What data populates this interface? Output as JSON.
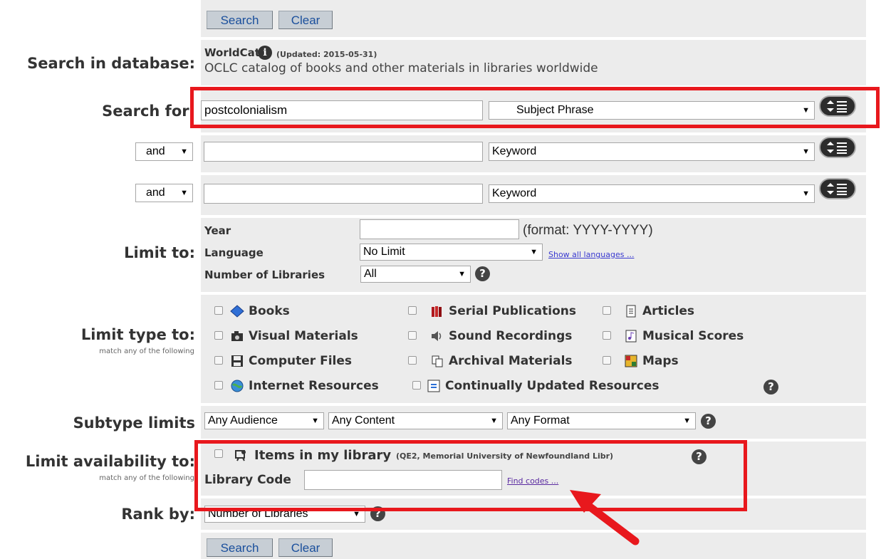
{
  "buttons": {
    "search": "Search",
    "clear": "Clear"
  },
  "database": {
    "label": "Search in database:",
    "name": "WorldCat",
    "updated": "(Updated: 2015-05-31)",
    "description": "OCLC catalog of books and other materials in libraries worldwide"
  },
  "search_for": {
    "label": "Search for:",
    "rows": [
      {
        "value": "postcolonialism",
        "index": "Subject Phrase"
      },
      {
        "bool": "and",
        "value": "",
        "index": "Keyword"
      },
      {
        "bool": "and",
        "value": "",
        "index": "Keyword"
      }
    ]
  },
  "limit_to": {
    "label": "Limit to:",
    "year_label": "Year",
    "year_format": "(format: YYYY-YYYY)",
    "language_label": "Language",
    "language_value": "No Limit",
    "show_all_languages": "Show all languages ...",
    "libraries_label": "Number of Libraries",
    "libraries_value": "All"
  },
  "limit_type": {
    "label": "Limit type to:",
    "sublabel": "match any of the following",
    "items": {
      "books": "Books",
      "serial": "Serial Publications",
      "articles": "Articles",
      "visual": "Visual Materials",
      "sound": "Sound Recordings",
      "scores": "Musical Scores",
      "computer": "Computer Files",
      "archival": "Archival Materials",
      "maps": "Maps",
      "internet": "Internet Resources",
      "continually": "Continually Updated Resources"
    }
  },
  "subtype": {
    "label": "Subtype limits",
    "audience": "Any Audience",
    "content": "Any Content",
    "format": "Any Format"
  },
  "availability": {
    "label": "Limit availability to:",
    "sublabel": "match any of the following",
    "items_label": "Items in my library",
    "items_note": "(QE2, Memorial University of Newfoundland Libr)",
    "code_label": "Library Code",
    "find_codes": "Find codes ..."
  },
  "rank": {
    "label": "Rank by:",
    "value": "Number of Libraries"
  },
  "help_glyph": "?",
  "info_glyph": "i",
  "colors": {
    "highlight": "#e8181d",
    "panel": "#ececec",
    "button_text": "#1a4f9c"
  }
}
